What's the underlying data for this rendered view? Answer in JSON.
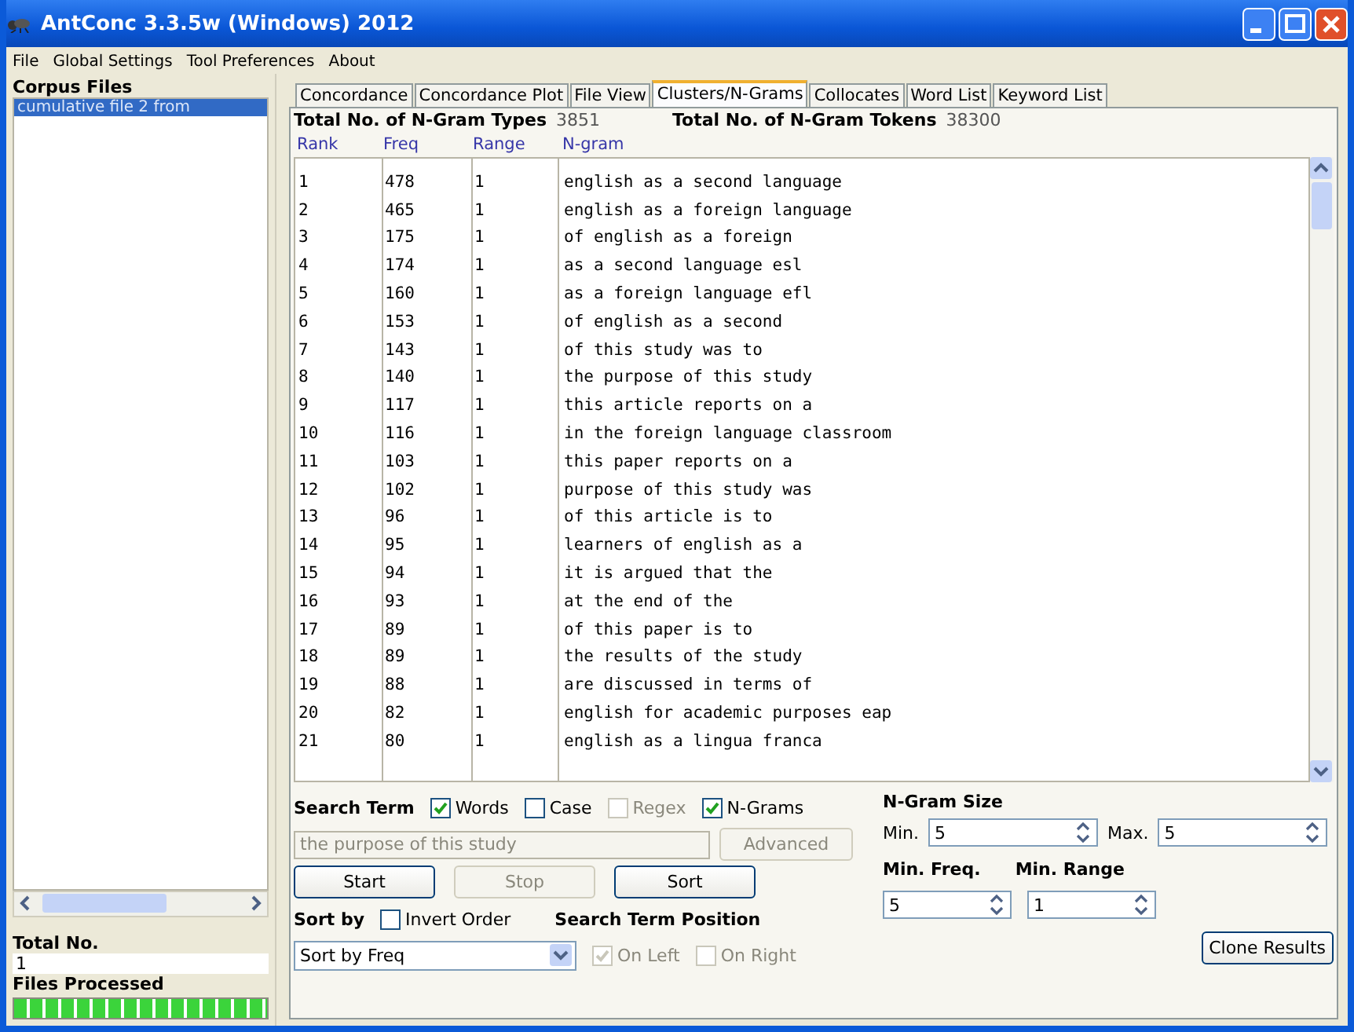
{
  "window": {
    "title": "AntConc 3.3.5w (Windows) 2012"
  },
  "menu": [
    "File",
    "Global Settings",
    "Tool Preferences",
    "About"
  ],
  "corpus_files": {
    "label": "Corpus Files",
    "items": [
      {
        "label": "cumulative file 2 from",
        "selected": true
      }
    ]
  },
  "total_no": {
    "label": "Total No.",
    "value": "1"
  },
  "files_processed": {
    "label": "Files Processed",
    "level": 1
  },
  "tabs": [
    {
      "label": "Concordance",
      "selected": false
    },
    {
      "label": "Concordance Plot",
      "selected": false
    },
    {
      "label": "File View",
      "selected": false
    },
    {
      "label": "Clusters/N-Grams",
      "selected": true
    },
    {
      "label": "Collocates",
      "selected": false
    },
    {
      "label": "Word List",
      "selected": false
    },
    {
      "label": "Keyword List",
      "selected": false
    }
  ],
  "totals": [
    {
      "label": "Total No. of N-Gram Types",
      "value": "3851"
    },
    {
      "label": "Total No. of N-Gram Tokens",
      "value": "38300"
    }
  ],
  "table": {
    "columns": [
      "Rank",
      "Freq",
      "Range",
      "N-gram"
    ],
    "rows": [
      [
        "1",
        "478",
        "1",
        "english as a second language"
      ],
      [
        "2",
        "465",
        "1",
        "english as a foreign language"
      ],
      [
        "3",
        "175",
        "1",
        "of english as a foreign"
      ],
      [
        "4",
        "174",
        "1",
        "as a second language esl"
      ],
      [
        "5",
        "160",
        "1",
        "as a foreign language efl"
      ],
      [
        "6",
        "153",
        "1",
        "of english as a second"
      ],
      [
        "7",
        "143",
        "1",
        "of this study was to"
      ],
      [
        "8",
        "140",
        "1",
        "the purpose of this study"
      ],
      [
        "9",
        "117",
        "1",
        "this article reports on a"
      ],
      [
        "10",
        "116",
        "1",
        "in the foreign language classroom"
      ],
      [
        "11",
        "103",
        "1",
        "this paper reports on a"
      ],
      [
        "12",
        "102",
        "1",
        "purpose of this study was"
      ],
      [
        "13",
        "96",
        "1",
        "of this article is to"
      ],
      [
        "14",
        "95",
        "1",
        "learners of english as a"
      ],
      [
        "15",
        "94",
        "1",
        "it is argued that the"
      ],
      [
        "16",
        "93",
        "1",
        "at the end of the"
      ],
      [
        "17",
        "89",
        "1",
        "of this paper is to"
      ],
      [
        "18",
        "89",
        "1",
        "the results of the study"
      ],
      [
        "19",
        "88",
        "1",
        "are discussed in terms of"
      ],
      [
        "20",
        "82",
        "1",
        "english for academic purposes eap"
      ],
      [
        "21",
        "80",
        "1",
        "english as a lingua franca"
      ]
    ]
  },
  "search": {
    "label": "Search Term",
    "options": [
      {
        "label": "Words",
        "checked": true,
        "disabled": false
      },
      {
        "label": "Case",
        "checked": false,
        "disabled": false
      },
      {
        "label": "Regex",
        "checked": false,
        "disabled": true
      },
      {
        "label": "N-Grams",
        "checked": true,
        "disabled": false
      }
    ],
    "value": "the purpose of this study",
    "disabled": true
  },
  "advanced": {
    "label": "Advanced",
    "disabled": true
  },
  "actions": [
    {
      "label": "Start",
      "disabled": false
    },
    {
      "label": "Stop",
      "disabled": true
    },
    {
      "label": "Sort",
      "disabled": false
    }
  ],
  "sort": {
    "label": "Sort by",
    "invert": {
      "label": "Invert Order",
      "checked": false,
      "disabled": false
    },
    "value": "Sort by Freq"
  },
  "position": {
    "label": "Search Term Position",
    "options": [
      {
        "label": "On Left",
        "checked": true,
        "disabled": true
      },
      {
        "label": "On Right",
        "checked": false,
        "disabled": true
      }
    ]
  },
  "ngram_size": {
    "label": "N-Gram Size",
    "min": {
      "label": "Min.",
      "value": "5"
    },
    "max": {
      "label": "Max.",
      "value": "5"
    }
  },
  "min_freq": {
    "label": "Min. Freq.",
    "value": "5"
  },
  "min_range": {
    "label": "Min. Range",
    "value": "1"
  },
  "clone": {
    "label": "Clone Results"
  }
}
